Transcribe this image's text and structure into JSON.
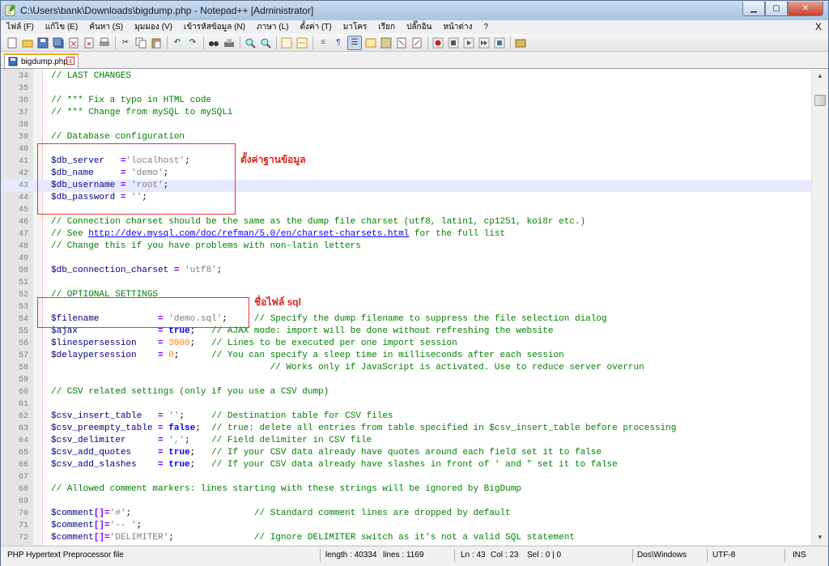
{
  "window": {
    "title": "C:\\Users\\bank\\Downloads\\bigdump.php - Notepad++ [Administrator]",
    "min": "▁",
    "max": "▢",
    "close": "✕"
  },
  "menu": {
    "items": [
      "ไฟล์ (F)",
      "แก้ไข (E)",
      "ค้นหา (S)",
      "มุมมอง (V)",
      "เข้ารหัสข้อมูล (N)",
      "ภาษา (L)",
      "ตั้งค่า (T)",
      "มาโคร",
      "เรียก",
      "ปลั๊กอิน",
      "หน้าต่าง",
      "?"
    ],
    "close_doc": "X"
  },
  "tab": {
    "label": "bigdump.php",
    "close": "x"
  },
  "annotations": {
    "db_settings": "ตั้งค่าฐานข้อมูล",
    "sql_file": "ชื่อไฟล์ sql"
  },
  "lines": [
    {
      "n": "34",
      "t": [
        [
          "cm",
          "// LAST CHANGES"
        ]
      ]
    },
    {
      "n": "35",
      "t": []
    },
    {
      "n": "36",
      "t": [
        [
          "cm",
          "// *** Fix a typo in HTML code"
        ]
      ]
    },
    {
      "n": "37",
      "t": [
        [
          "cm",
          "// *** Change from mySQL to mySQLi"
        ]
      ]
    },
    {
      "n": "38",
      "t": []
    },
    {
      "n": "39",
      "t": [
        [
          "cm",
          "// Database configuration"
        ]
      ]
    },
    {
      "n": "40",
      "t": []
    },
    {
      "n": "41",
      "t": [
        [
          "va",
          "$db_server"
        ],
        [
          "",
          "   "
        ],
        [
          "op",
          "="
        ],
        [
          "",
          "",
          " "
        ],
        [
          "st",
          "'localhost'"
        ],
        [
          "",
          ";"
        ]
      ]
    },
    {
      "n": "42",
      "t": [
        [
          "va",
          "$db_name"
        ],
        [
          "",
          "     "
        ],
        [
          "op",
          "="
        ],
        [
          "",
          " "
        ],
        [
          "st",
          "'demo'"
        ],
        [
          "",
          ";"
        ]
      ]
    },
    {
      "n": "43",
      "t": [
        [
          "va",
          "$db_username"
        ],
        [
          "",
          " "
        ],
        [
          "op",
          "="
        ],
        [
          "",
          " "
        ],
        [
          "st",
          "'root'"
        ],
        [
          "",
          ";"
        ]
      ],
      "cur": true
    },
    {
      "n": "44",
      "t": [
        [
          "va",
          "$db_password"
        ],
        [
          "",
          " "
        ],
        [
          "op",
          "="
        ],
        [
          "",
          " "
        ],
        [
          "st",
          "''"
        ],
        [
          "",
          ";"
        ]
      ]
    },
    {
      "n": "45",
      "t": []
    },
    {
      "n": "46",
      "t": [
        [
          "cm",
          "// Connection charset should be the same as the dump file charset (utf8, latin1, cp1251, koi8r etc.)"
        ]
      ]
    },
    {
      "n": "47",
      "t": [
        [
          "cm",
          "// See "
        ],
        [
          "lk",
          "http://dev.mysql.com/doc/refman/5.0/en/charset-charsets.html"
        ],
        [
          "cm",
          " for the full list"
        ]
      ]
    },
    {
      "n": "48",
      "t": [
        [
          "cm",
          "// Change this if you have problems with non-latin letters"
        ]
      ]
    },
    {
      "n": "49",
      "t": []
    },
    {
      "n": "50",
      "t": [
        [
          "va",
          "$db_connection_charset"
        ],
        [
          "",
          " "
        ],
        [
          "op",
          "="
        ],
        [
          "",
          " "
        ],
        [
          "st",
          "'utf8'"
        ],
        [
          "",
          ";"
        ]
      ]
    },
    {
      "n": "51",
      "t": []
    },
    {
      "n": "52",
      "t": [
        [
          "cm",
          "// OPTIONAL SETTINGS"
        ]
      ]
    },
    {
      "n": "53",
      "t": []
    },
    {
      "n": "54",
      "t": [
        [
          "va",
          "$filename"
        ],
        [
          "",
          "           "
        ],
        [
          "op",
          "="
        ],
        [
          "",
          " "
        ],
        [
          "st",
          "'demo.sql'"
        ],
        [
          "",
          ";"
        ],
        [
          "",
          "     "
        ],
        [
          "cm",
          "// Specify the dump filename to suppress the file selection dialog"
        ]
      ]
    },
    {
      "n": "55",
      "t": [
        [
          "va",
          "$ajax"
        ],
        [
          "",
          "               "
        ],
        [
          "op",
          "="
        ],
        [
          "",
          " "
        ],
        [
          "kw",
          "true"
        ],
        [
          "",
          ";"
        ],
        [
          "",
          "   "
        ],
        [
          "cm",
          "// AJAX mode: import will be done without refreshing the website"
        ]
      ]
    },
    {
      "n": "56",
      "t": [
        [
          "va",
          "$linespersession"
        ],
        [
          "",
          "    "
        ],
        [
          "op",
          "="
        ],
        [
          "",
          " "
        ],
        [
          "nm",
          "3000"
        ],
        [
          "",
          ";"
        ],
        [
          "",
          "   "
        ],
        [
          "cm",
          "// Lines to be executed per one import session"
        ]
      ]
    },
    {
      "n": "57",
      "t": [
        [
          "va",
          "$delaypersession"
        ],
        [
          "",
          "    "
        ],
        [
          "op",
          "="
        ],
        [
          "",
          " "
        ],
        [
          "nm",
          "0"
        ],
        [
          "",
          ";"
        ],
        [
          "",
          "      "
        ],
        [
          "cm",
          "// You can specify a sleep time in milliseconds after each session"
        ]
      ]
    },
    {
      "n": "58",
      "t": [
        [
          "",
          "                                         "
        ],
        [
          "cm",
          "// Works only if JavaScript is activated. Use to reduce server overrun"
        ]
      ]
    },
    {
      "n": "59",
      "t": []
    },
    {
      "n": "60",
      "t": [
        [
          "cm",
          "// CSV related settings (only if you use a CSV dump)"
        ]
      ]
    },
    {
      "n": "61",
      "t": []
    },
    {
      "n": "62",
      "t": [
        [
          "va",
          "$csv_insert_table"
        ],
        [
          "",
          "   "
        ],
        [
          "op",
          "="
        ],
        [
          "",
          " "
        ],
        [
          "st",
          "''"
        ],
        [
          "",
          ";"
        ],
        [
          "",
          "     "
        ],
        [
          "cm",
          "// Destination table for CSV files"
        ]
      ]
    },
    {
      "n": "63",
      "t": [
        [
          "va",
          "$csv_preempty_table"
        ],
        [
          "",
          " "
        ],
        [
          "op",
          "="
        ],
        [
          "",
          " "
        ],
        [
          "kw",
          "false"
        ],
        [
          "",
          ";"
        ],
        [
          "",
          "  "
        ],
        [
          "cm",
          "// true: delete all entries from table specified in $csv_insert_table before processing"
        ]
      ]
    },
    {
      "n": "64",
      "t": [
        [
          "va",
          "$csv_delimiter"
        ],
        [
          "",
          "      "
        ],
        [
          "op",
          "="
        ],
        [
          "",
          " "
        ],
        [
          "st",
          "','"
        ],
        [
          "",
          ";"
        ],
        [
          "",
          "    "
        ],
        [
          "cm",
          "// Field delimiter in CSV file"
        ]
      ]
    },
    {
      "n": "65",
      "t": [
        [
          "va",
          "$csv_add_quotes"
        ],
        [
          "",
          "     "
        ],
        [
          "op",
          "="
        ],
        [
          "",
          " "
        ],
        [
          "kw",
          "true"
        ],
        [
          "",
          ";"
        ],
        [
          "",
          "   "
        ],
        [
          "cm",
          "// If your CSV data already have quotes around each field set it to false"
        ]
      ]
    },
    {
      "n": "66",
      "t": [
        [
          "va",
          "$csv_add_slashes"
        ],
        [
          "",
          "    "
        ],
        [
          "op",
          "="
        ],
        [
          "",
          " "
        ],
        [
          "kw",
          "true"
        ],
        [
          "",
          ";"
        ],
        [
          "",
          "   "
        ],
        [
          "cm",
          "// If your CSV data already have slashes in front of ' and \" set it to false"
        ]
      ]
    },
    {
      "n": "67",
      "t": []
    },
    {
      "n": "68",
      "t": [
        [
          "cm",
          "// Allowed comment markers: lines starting with these strings will be ignored by BigDump"
        ]
      ]
    },
    {
      "n": "69",
      "t": []
    },
    {
      "n": "70",
      "t": [
        [
          "va",
          "$comment"
        ],
        [
          "op",
          "[]="
        ],
        [
          "st",
          "'#'"
        ],
        [
          "",
          ";"
        ],
        [
          "",
          "                       "
        ],
        [
          "cm",
          "// Standard comment lines are dropped by default"
        ]
      ]
    },
    {
      "n": "71",
      "t": [
        [
          "va",
          "$comment"
        ],
        [
          "op",
          "[]="
        ],
        [
          "st",
          "'-- '"
        ],
        [
          "",
          ";"
        ]
      ]
    },
    {
      "n": "72",
      "t": [
        [
          "va",
          "$comment"
        ],
        [
          "op",
          "[]="
        ],
        [
          "st",
          "'DELIMITER'"
        ],
        [
          "",
          ";"
        ],
        [
          "",
          "               "
        ],
        [
          "cm",
          "// Ignore DELIMITER switch as it's not a valid SQL statement"
        ]
      ]
    }
  ],
  "status": {
    "lang": "PHP Hypertext Preprocessor file",
    "length": "length : 40334",
    "lines": "lines : 1169",
    "ln": "Ln : 43",
    "col": "Col : 23",
    "sel": "Sel : 0 | 0",
    "eol": "Dos\\Windows",
    "enc": "UTF-8",
    "ins": "INS"
  }
}
